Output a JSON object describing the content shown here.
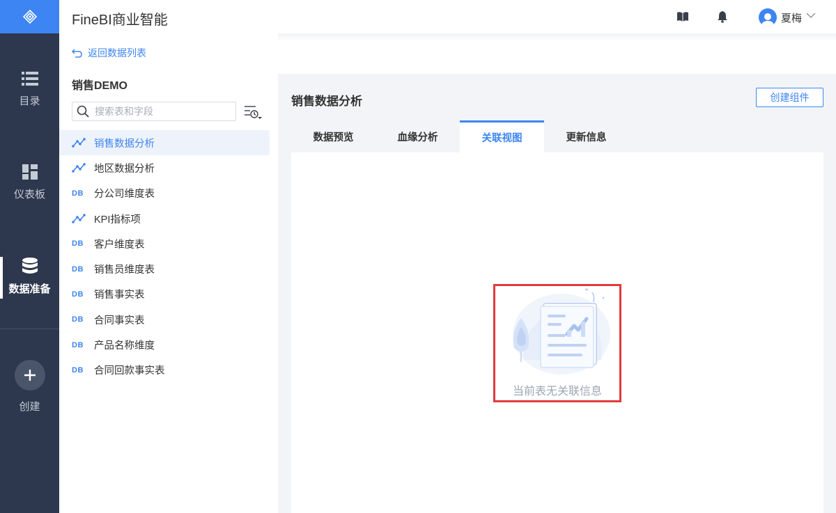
{
  "app": {
    "title": "FineBI商业智能"
  },
  "rail": {
    "items": [
      {
        "label": "目录",
        "icon": "list-icon"
      },
      {
        "label": "仪表板",
        "icon": "dashboard-icon"
      },
      {
        "label": "数据准备",
        "icon": "database-icon",
        "active": true
      },
      {
        "label": "创建",
        "icon": "plus-icon"
      }
    ]
  },
  "header": {
    "user_name": "夏梅"
  },
  "sidebar": {
    "back_label": "返回数据列表",
    "package_title": "销售DEMO",
    "search_placeholder": "搜索表和字段",
    "db_tag": "DB",
    "tables": [
      {
        "label": "销售数据分析",
        "type": "analysis",
        "selected": true
      },
      {
        "label": "地区数据分析",
        "type": "analysis"
      },
      {
        "label": "分公司维度表",
        "type": "db"
      },
      {
        "label": "KPI指标项",
        "type": "analysis"
      },
      {
        "label": "客户维度表",
        "type": "db"
      },
      {
        "label": "销售员维度表",
        "type": "db"
      },
      {
        "label": "销售事实表",
        "type": "db"
      },
      {
        "label": "合同事实表",
        "type": "db"
      },
      {
        "label": "产品名称维度",
        "type": "db"
      },
      {
        "label": "合同回款事实表",
        "type": "db"
      }
    ]
  },
  "main": {
    "title": "销售数据分析",
    "create_button": "创建组件",
    "tabs": [
      {
        "label": "数据预览"
      },
      {
        "label": "血缘分析"
      },
      {
        "label": "关联视图",
        "active": true
      },
      {
        "label": "更新信息"
      }
    ],
    "empty_text": "当前表无关联信息"
  },
  "colors": {
    "accent": "#3d85f2",
    "rail_bg": "#2d374d",
    "highlight": "#e03b3b"
  }
}
